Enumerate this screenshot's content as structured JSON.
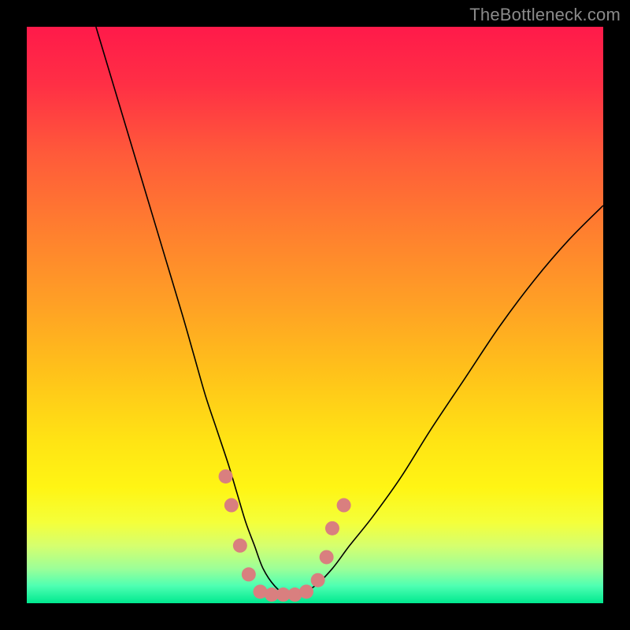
{
  "watermark": {
    "text": "TheBottleneck.com"
  },
  "colors": {
    "frame": "#000000",
    "curve_stroke": "#000000",
    "curve_stroke_width": 1.6,
    "marker_fill": "#d97f7f",
    "marker_radius": 9,
    "gradient_stops": [
      {
        "offset": 0.0,
        "color": "#ff1a4a"
      },
      {
        "offset": 0.1,
        "color": "#ff2f45"
      },
      {
        "offset": 0.22,
        "color": "#ff5a3a"
      },
      {
        "offset": 0.35,
        "color": "#ff7e2f"
      },
      {
        "offset": 0.48,
        "color": "#ffa025"
      },
      {
        "offset": 0.6,
        "color": "#ffc21a"
      },
      {
        "offset": 0.72,
        "color": "#ffe414"
      },
      {
        "offset": 0.8,
        "color": "#fff514"
      },
      {
        "offset": 0.86,
        "color": "#f4ff3a"
      },
      {
        "offset": 0.9,
        "color": "#d6ff6e"
      },
      {
        "offset": 0.94,
        "color": "#9cff98"
      },
      {
        "offset": 0.97,
        "color": "#4effb2"
      },
      {
        "offset": 1.0,
        "color": "#00e88f"
      }
    ]
  },
  "chart_data": {
    "type": "line",
    "title": "",
    "xlabel": "",
    "ylabel": "",
    "xlim": [
      0,
      100
    ],
    "ylim": [
      0,
      100
    ],
    "grid": false,
    "note": "Bottleneck-style V curve. y is a percentage (0 = bottom/green = no bottleneck, 100 = top/red = full bottleneck). x is a normalized horizontal unit (0–100 across the visible plot). Values are read off the plotted curve relative to the gradient background; no axis ticks are rendered in the source image, so values are estimates at the precision the image implies.",
    "series": [
      {
        "name": "curve",
        "x": [
          12,
          15,
          18,
          21,
          24,
          27,
          29,
          31,
          33,
          35,
          36.5,
          38,
          39.5,
          41,
          43,
          45,
          47,
          50,
          53,
          56,
          60,
          65,
          70,
          76,
          82,
          88,
          94,
          100
        ],
        "y": [
          100,
          90,
          80,
          70,
          60,
          50,
          43,
          36,
          30,
          24,
          19,
          14,
          10,
          6,
          3,
          1.5,
          1.5,
          3,
          6,
          10,
          15,
          22,
          30,
          39,
          48,
          56,
          63,
          69
        ]
      }
    ],
    "markers": {
      "name": "highlight-dots",
      "note": "Salmon dots near the valley of the curve (approx. positions).",
      "points": [
        {
          "x": 34.5,
          "y": 22
        },
        {
          "x": 35.5,
          "y": 17
        },
        {
          "x": 37,
          "y": 10
        },
        {
          "x": 38.5,
          "y": 5
        },
        {
          "x": 40.5,
          "y": 2
        },
        {
          "x": 42.5,
          "y": 1.5
        },
        {
          "x": 44.5,
          "y": 1.5
        },
        {
          "x": 46.5,
          "y": 1.5
        },
        {
          "x": 48.5,
          "y": 2
        },
        {
          "x": 50.5,
          "y": 4
        },
        {
          "x": 52,
          "y": 8
        },
        {
          "x": 53,
          "y": 13
        },
        {
          "x": 55,
          "y": 17
        }
      ]
    }
  }
}
